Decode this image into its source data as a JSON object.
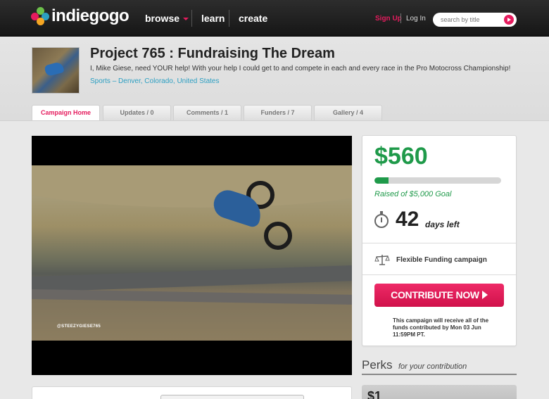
{
  "nav": {
    "brand": "indiegogo",
    "links": [
      "browse",
      "learn",
      "create"
    ],
    "signup": "Sign Up",
    "login": "Log In",
    "search_placeholder": "search by title"
  },
  "project": {
    "title": "Project 765 : Fundraising The Dream",
    "description": "I, Mike Giese, need YOUR help! With your help I could get to and compete in each and every race in the Pro Motocross Championship!",
    "category": "Sports",
    "separator": "–",
    "location": [
      "Denver",
      "Colorado",
      "United States"
    ]
  },
  "tabs": [
    {
      "label": "Campaign Home"
    },
    {
      "label": "Updates / 0"
    },
    {
      "label": "Comments / 1"
    },
    {
      "label": "Funders / 7"
    },
    {
      "label": "Gallery / 4"
    }
  ],
  "video": {
    "watermark": "@STEEZYGIESE765"
  },
  "funding": {
    "amount": "$560",
    "goal_text": "Raised of $5,000 Goal",
    "progress_fraction": 0.112,
    "days_left": "42",
    "days_label": "days left",
    "funding_type": "Flexible Funding campaign",
    "contribute_label": "CONTRIBUTE NOW",
    "note": "This campaign will receive all of the funds contributed by Mon 03 Jun 11:59PM PT."
  },
  "perks": {
    "title": "Perks",
    "subtitle": "for your contribution",
    "first_amount": "$1"
  },
  "colors": {
    "accent": "#e51c5e",
    "green": "#1f9a4a",
    "link": "#2c9fc2",
    "logo_dots": [
      "#6cc04a",
      "#e51c5e",
      "#2c9fc2",
      "#f5a623"
    ]
  }
}
